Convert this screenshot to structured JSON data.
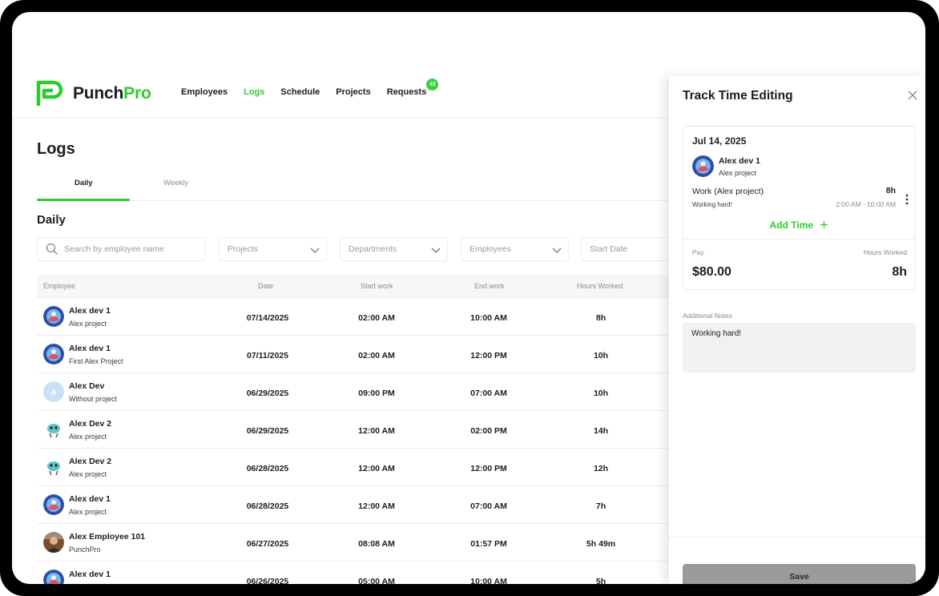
{
  "brand": {
    "name_part1": "Punch",
    "name_part2": "Pro",
    "color": "#2ecb2e"
  },
  "nav": {
    "items": [
      {
        "label": "Employees",
        "active": false
      },
      {
        "label": "Logs",
        "active": true
      },
      {
        "label": "Schedule",
        "active": false
      },
      {
        "label": "Projects",
        "active": false
      },
      {
        "label": "Requests",
        "active": false
      }
    ],
    "requests_badge": "43"
  },
  "page": {
    "title": "Logs",
    "section_title": "Daily"
  },
  "tabs": [
    {
      "label": "Daily",
      "active": true
    },
    {
      "label": "Weekly",
      "active": false
    }
  ],
  "filters": {
    "search_placeholder": "Search by employee name",
    "projects": "Projects",
    "departments": "Departments",
    "employees": "Employees",
    "start_date": "Start Date"
  },
  "table": {
    "columns": [
      "Employee",
      "Date",
      "Start work",
      "End work",
      "Hours Worked"
    ],
    "rows": [
      {
        "name": "Alex dev 1",
        "project": "Alex project",
        "date": "07/14/2025",
        "start": "02:00 AM",
        "end": "10:00 AM",
        "hours": "8h",
        "avatar": "photo-avatar-icon"
      },
      {
        "name": "Alex dev 1",
        "project": "First Alex Project",
        "date": "07/11/2025",
        "start": "02:00 AM",
        "end": "12:00 PM",
        "hours": "10h",
        "avatar": "photo-avatar-icon"
      },
      {
        "name": "Alex Dev",
        "project": "Without project",
        "date": "06/29/2025",
        "start": "09:00 PM",
        "end": "07:00 AM",
        "hours": "10h",
        "avatar": "initial-avatar-icon",
        "initial": "A"
      },
      {
        "name": "Alex Dev 2",
        "project": "Alex project",
        "date": "06/29/2025",
        "start": "12:00 AM",
        "end": "02:00 PM",
        "hours": "14h",
        "avatar": "cartoon-avatar-icon"
      },
      {
        "name": "Alex Dev 2",
        "project": "Alex project",
        "date": "06/28/2025",
        "start": "12:00 AM",
        "end": "12:00 PM",
        "hours": "12h",
        "avatar": "cartoon-avatar-icon"
      },
      {
        "name": "Alex dev 1",
        "project": "Alex project",
        "date": "06/28/2025",
        "start": "12:00 AM",
        "end": "07:00 AM",
        "hours": "7h",
        "avatar": "photo-avatar-icon"
      },
      {
        "name": "Alex Employee 101",
        "project": "PunchPro",
        "date": "06/27/2025",
        "start": "08:08 AM",
        "end": "01:57 PM",
        "hours": "5h 49m",
        "avatar": "person-photo-avatar-icon"
      },
      {
        "name": "Alex dev 1",
        "project": "",
        "date": "06/26/2025",
        "start": "05:00 AM",
        "end": "10:00 AM",
        "hours": "5h",
        "avatar": "photo-avatar-icon"
      }
    ]
  },
  "drawer": {
    "title": "Track Time Editing",
    "date": "Jul 14, 2025",
    "employee_name": "Alex dev 1",
    "employee_project": "Alex project",
    "work_label": "Work (Alex project)",
    "work_hours": "8h",
    "work_note": "Working hard!",
    "work_range": "2:00 AM - 10:00 AM",
    "add_time_label": "Add Time",
    "pay_label": "Pay",
    "hours_worked_label": "Hours Worked",
    "pay_value": "$80.00",
    "hours_worked_value": "8h",
    "notes_label": "Additional Notes",
    "notes_value": "Working hard!",
    "save_label": "Save"
  }
}
